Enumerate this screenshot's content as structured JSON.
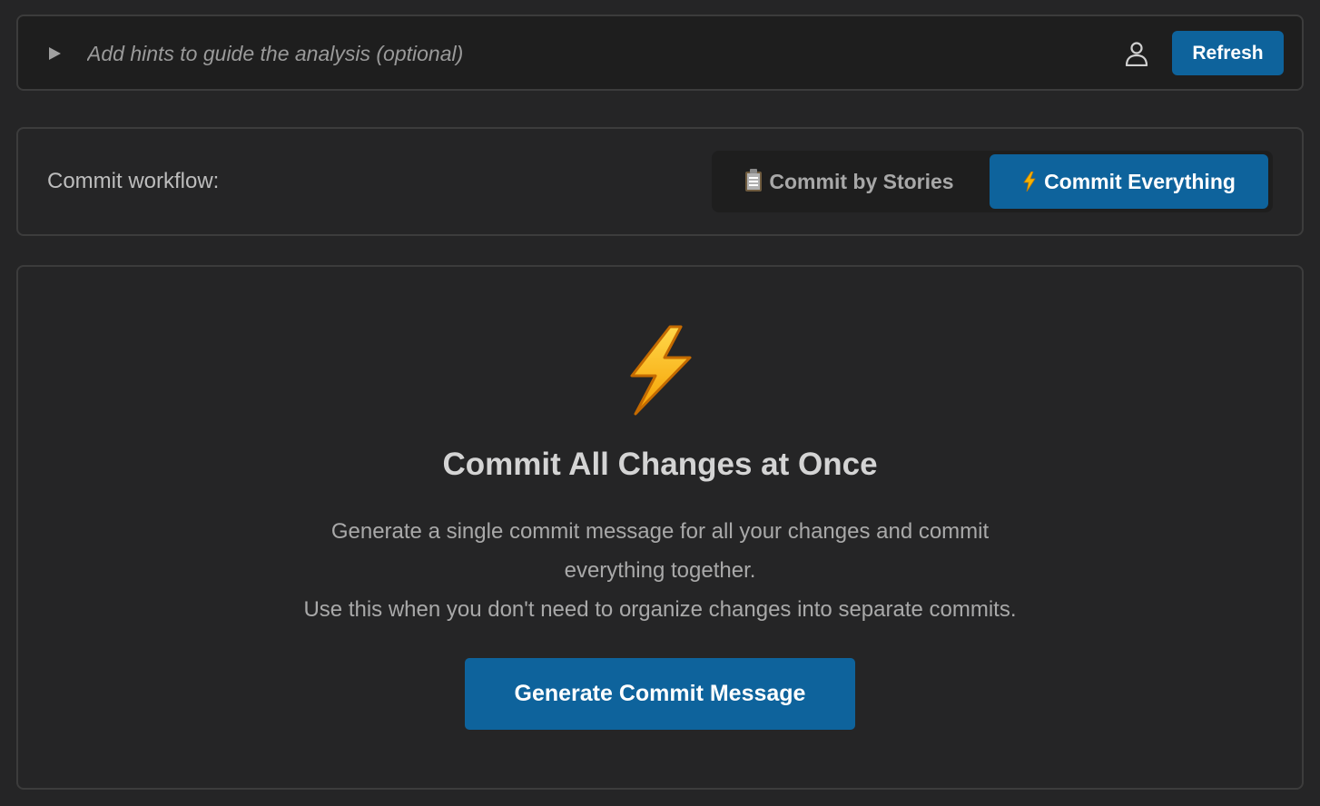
{
  "hints": {
    "placeholder": "Add hints to guide the analysis (optional)",
    "value": "",
    "toggle_icon": "play-triangle-icon",
    "user_icon": "user-icon",
    "refresh_label": "Refresh"
  },
  "workflow": {
    "label": "Commit workflow:",
    "options": [
      {
        "icon": "clipboard-icon",
        "label": "Commit by Stories",
        "selected": false
      },
      {
        "icon": "lightning-icon",
        "label": "Commit Everything",
        "selected": true
      }
    ]
  },
  "main": {
    "icon": "lightning-icon",
    "title": "Commit All Changes at Once",
    "description_lines": [
      "Generate a single commit message for all your changes and commit",
      "everything together.",
      "Use this when you don't need to organize changes into separate commits."
    ],
    "button_label": "Generate Commit Message"
  },
  "colors": {
    "background": "#252526",
    "accent": "#0e639c",
    "border": "#3c3c3c",
    "bolt": "#f5b301"
  }
}
